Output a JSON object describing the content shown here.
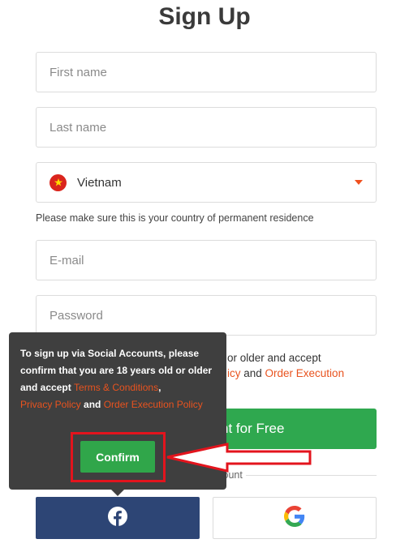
{
  "page": {
    "title": "Sign Up"
  },
  "form": {
    "first_name_placeholder": "First name",
    "last_name_placeholder": "Last name",
    "country_value": "Vietnam",
    "country_flag_icon": "vietnam-flag-icon",
    "residence_note": "Please make sure this is your country of permanent residence",
    "email_placeholder": "E-mail",
    "password_placeholder": "Password",
    "consent_visible_line1": "or older and accept",
    "consent_visible_link1": "icy",
    "consent_visible_and": " and ",
    "consent_visible_link2": "Order Execution",
    "create_button_visible": "nt for Free",
    "social_divider_visible": "ccount"
  },
  "tooltip": {
    "text_part1": "To sign up via Social Accounts, please confirm that you are 18 years old or older and accept ",
    "terms_link": "Terms & Conditions",
    "comma": ",",
    "privacy_link": "Privacy Policy",
    "and": " and ",
    "order_link": "Order Execution Policy",
    "confirm_label": "Confirm"
  },
  "social": {
    "facebook_icon": "facebook-icon",
    "google_icon": "google-icon"
  },
  "colors": {
    "accent_orange": "#e8531f",
    "button_green": "#2fa84f",
    "facebook_blue": "#2d4575",
    "tooltip_bg": "#3f3f3f",
    "highlight_red": "#e3141d"
  }
}
